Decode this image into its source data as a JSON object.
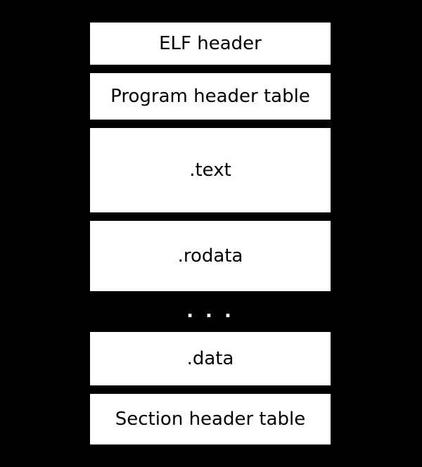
{
  "diagram": {
    "elf_header": "ELF header",
    "program_header_table": "Program header table",
    "text_section": ".text",
    "rodata_section": ".rodata",
    "ellipsis": ". . .",
    "data_section": ".data",
    "section_header_table": "Section header table"
  }
}
